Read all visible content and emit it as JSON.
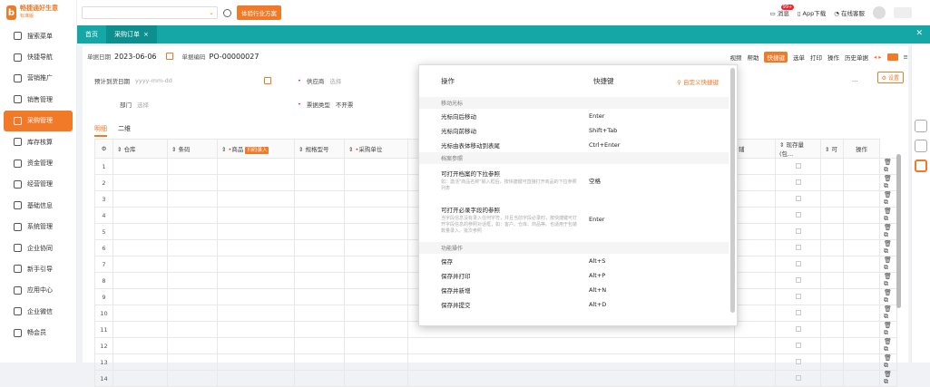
{
  "app": {
    "name": "畅捷通好生意",
    "sub": "标准版"
  },
  "sidebar": {
    "items": [
      {
        "label": "搜索菜单"
      },
      {
        "label": "快捷导航"
      },
      {
        "label": "营销推广"
      },
      {
        "label": "销售管理"
      },
      {
        "label": "采购管理"
      },
      {
        "label": "库存核算"
      },
      {
        "label": "资金管理"
      },
      {
        "label": "经营管理"
      },
      {
        "label": "基础信息"
      },
      {
        "label": "系统管理"
      },
      {
        "label": "企业协同"
      },
      {
        "label": "新手引导"
      },
      {
        "label": "应用中心"
      },
      {
        "label": "企业微信"
      },
      {
        "label": "畅会员"
      }
    ],
    "active_index": 4
  },
  "topbar": {
    "plan_button": "体验行业方案",
    "messages": "消息",
    "msg_badge": "99+",
    "app_download": "App下载",
    "support": "在线客服"
  },
  "tabs": [
    {
      "label": "首页"
    },
    {
      "label": "采购订单",
      "close": "×"
    }
  ],
  "toolbar": {
    "date_label": "单据日期",
    "date_value": "2023-06-06",
    "no_label": "单据编码",
    "no_value": "PO-00000027",
    "right": [
      "视频",
      "帮助",
      "快捷键",
      "选单",
      "打印",
      "操作",
      "历史单据"
    ]
  },
  "form": {
    "expected_date_label": "预计到货日期",
    "expected_date_ph": "yyyy-mm-dd",
    "supplier_label": "供应商",
    "supplier_ph": "选择",
    "dept_label": "部门",
    "dept_ph": "选择",
    "invoice_label": "票据类型",
    "invoice_value": "不开票",
    "more": "...",
    "settings": "设置"
  },
  "subtabs": [
    "明细",
    "二维"
  ],
  "grid": {
    "headers": [
      "仓库",
      "条码",
      "商品",
      "扫码录入",
      "规格型号",
      "采购单位",
      "辅",
      "现存量 (包...",
      "可",
      "操作"
    ],
    "rows": [
      "1",
      "2",
      "3",
      "4",
      "5",
      "6",
      "7",
      "8",
      "9",
      "10",
      "11",
      "12",
      "13",
      "14"
    ]
  },
  "popup": {
    "col_op": "操作",
    "col_key": "快捷键",
    "custom": "自定义快捷键",
    "sections": [
      {
        "title": "移动光标",
        "rows": [
          {
            "op": "光标向后移动",
            "key": "Enter"
          },
          {
            "op": "光标向前移动",
            "key": "Shift+Tab"
          },
          {
            "op": "光标由表体移动到表尾",
            "key": "Ctrl+Enter"
          }
        ]
      },
      {
        "title": "档案参照",
        "rows": [
          {
            "op": "可打开档案的下拉参照",
            "desc": "如：激活\"商品名称\"输入框后，按快捷键可直接打开商品的下拉参照列表",
            "key": "空格"
          },
          {
            "op": "可打开必录字段的参照",
            "desc": "当字段信息没有录入任何字符，并且当前字段必录时，按快捷键可打开字段信息的参照对话框，如：客户、仓库、商品等。也适用于包装数量录入、批次参照",
            "key": "Enter"
          }
        ]
      },
      {
        "title": "功能操作",
        "rows": [
          {
            "op": "保存",
            "key": "Alt+S"
          },
          {
            "op": "保存并打印",
            "key": "Alt+P"
          },
          {
            "op": "保存并新增",
            "key": "Alt+N"
          },
          {
            "op": "保存并提交",
            "key": "Alt+D"
          }
        ]
      }
    ]
  }
}
